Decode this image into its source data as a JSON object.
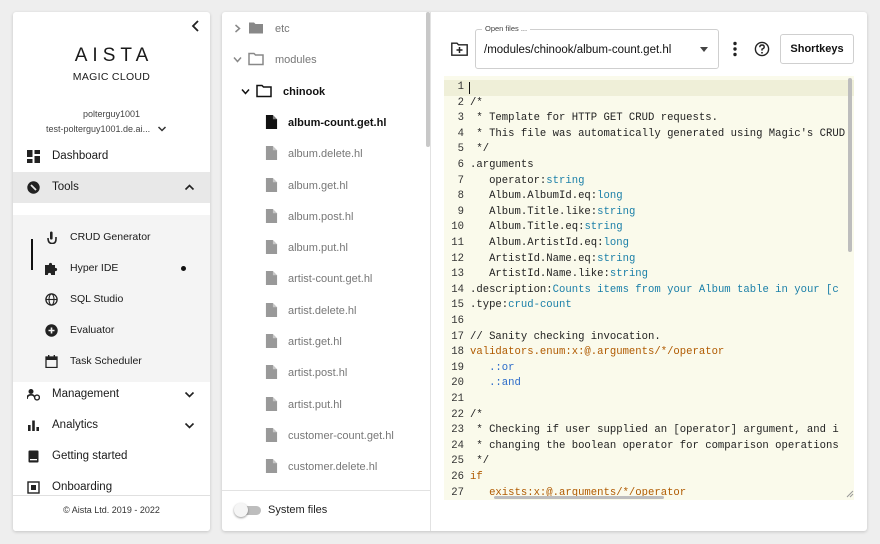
{
  "sidebar": {
    "logo": "AISTA",
    "logo_sub": "MAGIC CLOUD",
    "user_name": "polterguy1001",
    "user_domain": "test-polterguy1001.de.ai...",
    "nav": {
      "dashboard": "Dashboard",
      "tools": "Tools",
      "management": "Management",
      "analytics": "Analytics",
      "getting_started": "Getting started",
      "onboarding": "Onboarding"
    },
    "tools_items": [
      {
        "label": "CRUD Generator",
        "icon": "touch-icon"
      },
      {
        "label": "Hyper IDE",
        "icon": "puzzle-icon"
      },
      {
        "label": "SQL Studio",
        "icon": "globe-icon"
      },
      {
        "label": "Evaluator",
        "icon": "plus-circle-icon"
      },
      {
        "label": "Task Scheduler",
        "icon": "calendar-icon"
      }
    ],
    "footer": "© Aista Ltd. 2019 - 2022"
  },
  "tree": {
    "rows": [
      {
        "label": "etc",
        "kind": "folder",
        "expanded": false
      },
      {
        "label": "modules",
        "kind": "folder",
        "expanded": true
      },
      {
        "label": "chinook",
        "kind": "folder",
        "expanded": true
      },
      {
        "label": "album-count.get.hl",
        "kind": "file",
        "selected": true
      },
      {
        "label": "album.delete.hl",
        "kind": "file"
      },
      {
        "label": "album.get.hl",
        "kind": "file"
      },
      {
        "label": "album.post.hl",
        "kind": "file"
      },
      {
        "label": "album.put.hl",
        "kind": "file"
      },
      {
        "label": "artist-count.get.hl",
        "kind": "file"
      },
      {
        "label": "artist.delete.hl",
        "kind": "file"
      },
      {
        "label": "artist.get.hl",
        "kind": "file"
      },
      {
        "label": "artist.post.hl",
        "kind": "file"
      },
      {
        "label": "artist.put.hl",
        "kind": "file"
      },
      {
        "label": "customer-count.get.hl",
        "kind": "file"
      },
      {
        "label": "customer.delete.hl",
        "kind": "file"
      }
    ],
    "system_files_label": "System files",
    "system_files_on": false
  },
  "editor": {
    "open_files_label": "Open files ...",
    "open_file_value": "/modules/chinook/album-count.get.hl",
    "shortkeys_label": "Shortkeys",
    "lines": [
      {
        "n": "1",
        "t": ""
      },
      {
        "n": "2",
        "t": "/*"
      },
      {
        "n": "3",
        "t": " * Template for HTTP GET CRUD requests."
      },
      {
        "n": "4",
        "t": " * This file was automatically generated using Magic's CRUD"
      },
      {
        "n": "5",
        "t": " */"
      },
      {
        "n": "6",
        "t": ".arguments"
      },
      {
        "n": "7",
        "t": "   operator:string"
      },
      {
        "n": "8",
        "t": "   Album.AlbumId.eq:long"
      },
      {
        "n": "9",
        "t": "   Album.Title.like:string"
      },
      {
        "n": "10",
        "t": "   Album.Title.eq:string"
      },
      {
        "n": "11",
        "t": "   Album.ArtistId.eq:long"
      },
      {
        "n": "12",
        "t": "   ArtistId.Name.eq:string"
      },
      {
        "n": "13",
        "t": "   ArtistId.Name.like:string"
      },
      {
        "n": "14",
        "t": ".description:Counts items from your Album table in your [c"
      },
      {
        "n": "15",
        "t": ".type:crud-count"
      },
      {
        "n": "16",
        "t": ""
      },
      {
        "n": "17",
        "t": "// Sanity checking invocation."
      },
      {
        "n": "18",
        "t": "validators.enum:x:@.arguments/*/operator"
      },
      {
        "n": "19",
        "t": "   .:or"
      },
      {
        "n": "20",
        "t": "   .:and"
      },
      {
        "n": "21",
        "t": ""
      },
      {
        "n": "22",
        "t": "/*"
      },
      {
        "n": "23",
        "t": " * Checking if user supplied an [operator] argument, and i"
      },
      {
        "n": "24",
        "t": " * changing the boolean operator for comparison operations"
      },
      {
        "n": "25",
        "t": " */"
      },
      {
        "n": "26",
        "t": "if"
      },
      {
        "n": "27",
        "t": "   exists:x:@.arguments/*/operator"
      }
    ]
  }
}
